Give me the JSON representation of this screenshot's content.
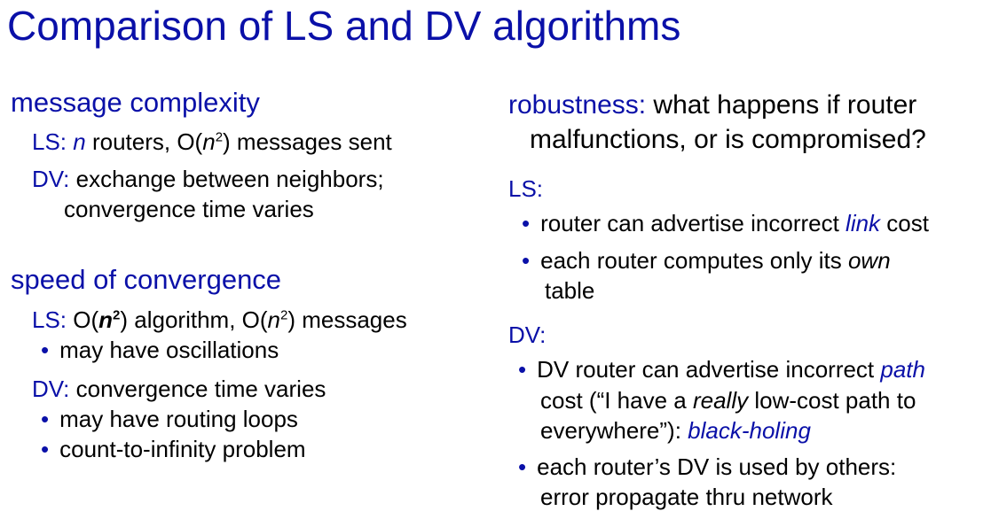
{
  "title": "Comparison of LS and DV algorithms",
  "left": {
    "message_complexity": {
      "heading": "message complexity",
      "ls_prefix": "LS:",
      "ls_n": "n",
      "ls_text1": " routers, O(",
      "ls_n2": "n",
      "ls_sup": "2",
      "ls_text2": ") messages sent",
      "dv_prefix": "DV:",
      "dv_text": " exchange between neighbors;",
      "dv_cont": "convergence time varies"
    },
    "speed": {
      "heading": "speed of convergence",
      "ls_prefix": "LS:",
      "ls_a": " O(",
      "ls_n": "n",
      "ls_sup": "2",
      "ls_b": ") algorithm, O(",
      "ls_n2": "n",
      "ls_sup2": "2",
      "ls_c": ") messages",
      "ls_bullets": [
        "may have oscillations"
      ],
      "dv_prefix": "DV:",
      "dv_text": " convergence time varies",
      "dv_bullets": [
        "may have routing loops",
        "count-to-infinity problem"
      ]
    }
  },
  "right": {
    "robustness": {
      "heading": "robustness:",
      "question1": " what happens if router",
      "question2": "malfunctions, or is compromised?",
      "ls_label": "LS:",
      "ls_b1_a": "router can advertise incorrect ",
      "ls_b1_em": "link",
      "ls_b1_b": " cost",
      "ls_b2_a": "each router computes only its ",
      "ls_b2_em": "own",
      "ls_b2_c": "table",
      "dv_label": "DV:",
      "dv_b1_a": "DV router can advertise incorrect ",
      "dv_b1_em": "path",
      "dv_b1_l2a": "cost (“I have a ",
      "dv_b1_l2em": "really",
      "dv_b1_l2b": " low-cost path to",
      "dv_b1_l3a": "everywhere”): ",
      "dv_b1_l3em": "black-holing",
      "dv_b2_l1": "each router’s DV is used by others:",
      "dv_b2_l2": "error propagate thru network"
    }
  },
  "bullet_char": "•"
}
